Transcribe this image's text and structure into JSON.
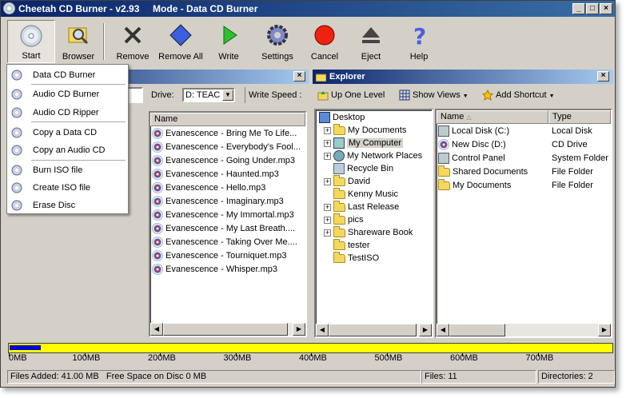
{
  "window": {
    "title": "Cheetah CD Burner - v2.93     Mode - Data CD Burner"
  },
  "toolbar": {
    "start": "Start",
    "browser": "Browser",
    "remove": "Remove",
    "remove_all": "Remove All",
    "write": "Write",
    "settings": "Settings",
    "cancel": "Cancel",
    "eject": "Eject",
    "help": "Help"
  },
  "start_menu": {
    "items": [
      "Data CD Burner",
      "Audio CD Burner",
      "Audio CD Ripper",
      "Copy a Data CD",
      "Copy an Audio CD",
      "Burn ISO file",
      "Create ISO file",
      "Erase Disc"
    ]
  },
  "left_panel": {
    "drive_label": "Drive:",
    "drive_value": "D: TEAC",
    "write_speed_label": "Write Speed :",
    "column_name": "Name",
    "files": [
      "Evanescence - Bring Me To Life...",
      "Evanescence - Everybody's Fool...",
      "Evanescence - Going Under.mp3",
      "Evanescence - Haunted.mp3",
      "Evanescence - Hello.mp3",
      "Evanescence - Imaginary.mp3",
      "Evanescence - My Immortal.mp3",
      "Evanescence - My Last Breath....",
      "Evanescence - Taking Over Me....",
      "Evanescence - Tourniquet.mp3",
      "Evanescence - Whisper.mp3"
    ]
  },
  "explorer": {
    "title": "Explorer",
    "up_one_level": "Up One Level",
    "show_views": "Show Views",
    "add_shortcut": "Add Shortcut",
    "tree": [
      "Desktop",
      "My Documents",
      "My Computer",
      "My Network Places",
      "Recycle Bin",
      "David",
      "Kenny Music",
      "Last Release",
      "pics",
      "Shareware Book",
      "tester",
      "TestISO"
    ],
    "col_name": "Name",
    "col_type": "Type",
    "items": [
      {
        "name": "Local Disk (C:)",
        "type": "Local Disk"
      },
      {
        "name": "New Disc (D:)",
        "type": "CD Drive"
      },
      {
        "name": "Control Panel",
        "type": "System Folder"
      },
      {
        "name": "Shared Documents",
        "type": "File Folder"
      },
      {
        "name": "My Documents",
        "type": "File Folder"
      }
    ]
  },
  "capacity": {
    "fill_fraction": 0.052,
    "ticks": [
      "0MB",
      "100MB",
      "200MB",
      "300MB",
      "400MB",
      "500MB",
      "600MB",
      "700MB"
    ]
  },
  "status": {
    "files_added": "Files Added: 41.00 MB   Free Space on Disc 0 MB",
    "files": "Files: 11",
    "directories": "Directories: 2"
  },
  "colors": {
    "accent": "#0a246a",
    "capacity_bar": "#ffff00",
    "capacity_fill": "#0000cc"
  }
}
